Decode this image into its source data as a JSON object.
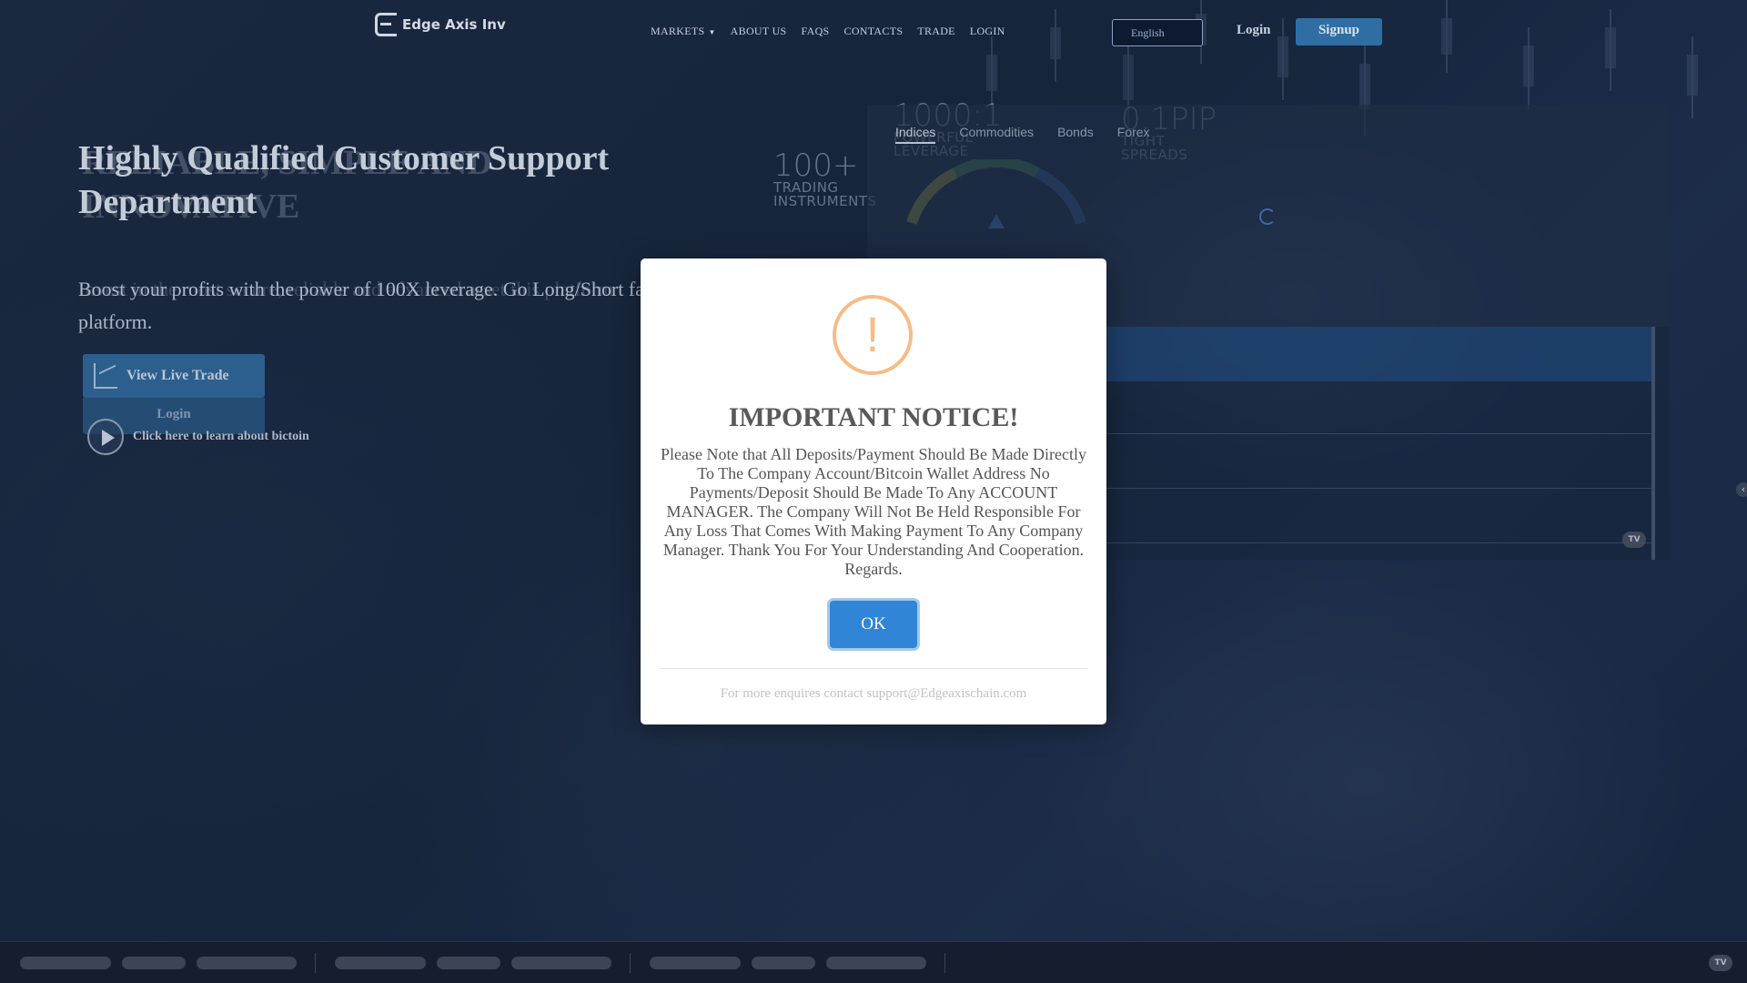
{
  "navbar": {
    "brand": "Edge Axis Inv",
    "links": [
      {
        "label": "MARKETS",
        "has_dropdown": true
      },
      {
        "label": "ABOUT US"
      },
      {
        "label": "FAQS"
      },
      {
        "label": "CONTACTS"
      },
      {
        "label": "TRADE"
      },
      {
        "label": "LOGIN"
      }
    ],
    "language": "English",
    "login_label": "Login",
    "signup_label": "Signup"
  },
  "hero": {
    "title": "Highly Qualified Customer Support Department",
    "title_ghost": "RELIABLE, SIMPLE AND INNOVATIVE",
    "subtitle": "Boost your profits with the power of 100X leverage. Go Long/Short fast platform.",
    "subtitle_ghost": "Invest in the most secure, reliable and advanced asset this platform",
    "view_live_trade_label": "View Live Trade",
    "login_button_label": "Login",
    "learn_bitcoin_label": "Click here to learn about bictoin"
  },
  "stats": {
    "instruments_big": "100+",
    "instruments_line1": "TRADING",
    "instruments_line2": "INSTRUMENTS",
    "leverage_big": "1000:1",
    "leverage_line1": "POWERFUL",
    "leverage_line2": "LEVERAGE",
    "spreads_big": "0.1PIP",
    "spreads_line1": "TIGHT",
    "spreads_line2": "SPREADS"
  },
  "widget": {
    "tabs": [
      "Indices",
      "Commodities",
      "Bonds",
      "Forex"
    ],
    "active_tab": "Indices",
    "badge": "TV"
  },
  "ticker": {
    "badge": "TV"
  },
  "modal": {
    "icon_glyph": "!",
    "title": "IMPORTANT NOTICE!",
    "body": "Please Note that All Deposits/Payment Should Be Made Directly To The Company Account/Bitcoin Wallet Address No Payments/Deposit Should Be Made To Any ACCOUNT MANAGER. The Company Will Not Be Held Responsible For Any Loss That Comes With Making Payment To Any Company Manager. Thank You For Your Understanding And Cooperation. Regards.",
    "ok_label": "OK",
    "footer": "For more enquires contact support@Edgeaxischain.com"
  },
  "side_arrow_glyph": "‹",
  "colors": {
    "modal_button": "#3085d6",
    "warning_icon": "#f8bb86",
    "signup_button": "#2f6ea3"
  }
}
